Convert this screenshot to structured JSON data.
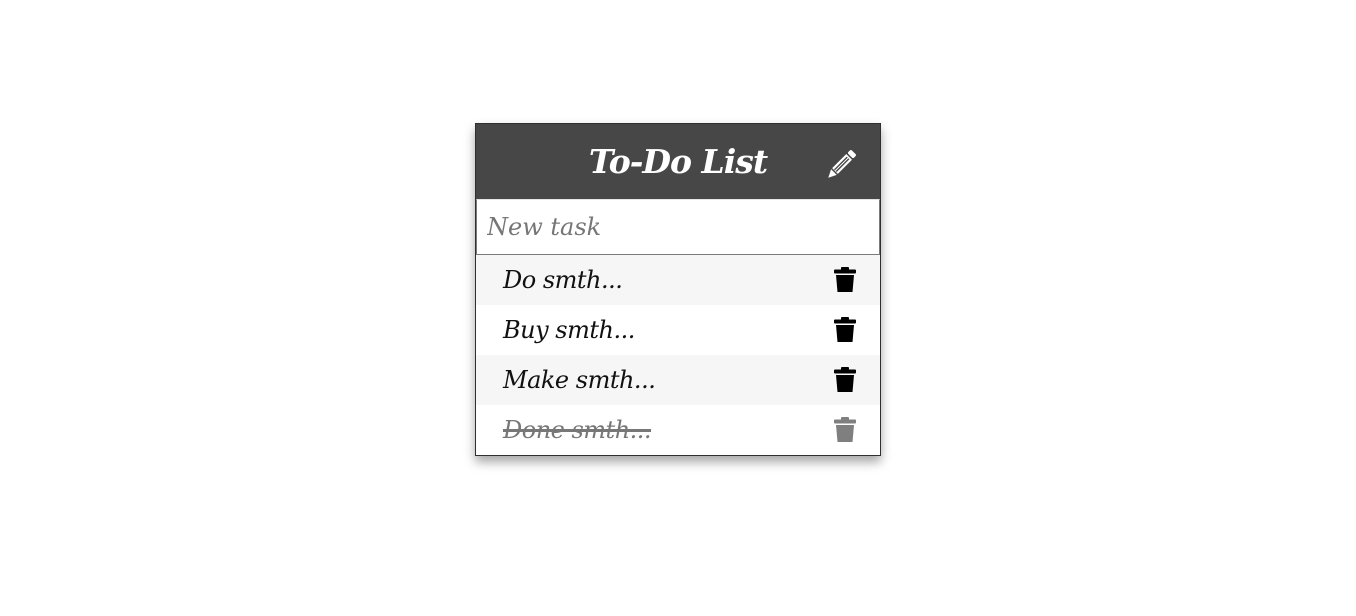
{
  "header": {
    "title": "To-Do List",
    "edit_icon": "pencil-icon"
  },
  "new_task": {
    "placeholder": "New task",
    "value": ""
  },
  "tasks": [
    {
      "label": "Do smth...",
      "done": false
    },
    {
      "label": "Buy smth...",
      "done": false
    },
    {
      "label": "Make smth...",
      "done": false
    },
    {
      "label": "Done smth...",
      "done": true
    }
  ],
  "colors": {
    "header_bg": "#474747",
    "trash_active": "#000000",
    "trash_done": "#7f7f7f"
  }
}
